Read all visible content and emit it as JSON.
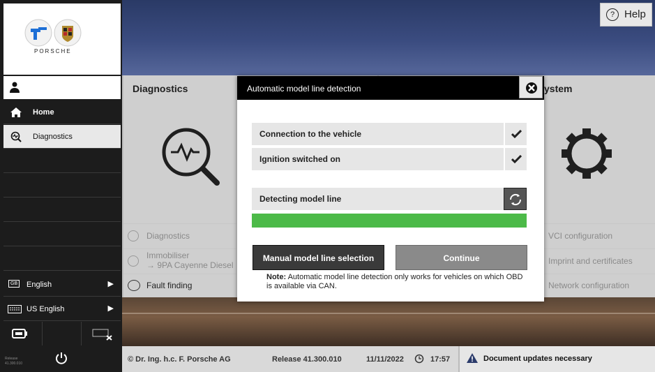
{
  "brand": {
    "logo_text": "PORSCHE"
  },
  "sidebar": {
    "items": [
      {
        "label": "Home",
        "icon": "home-icon"
      },
      {
        "label": "Diagnostics",
        "icon": "diagnostics-icon"
      }
    ],
    "language": "English",
    "language_badge": "GB",
    "keyboard": "US English",
    "release_small_label": "Release",
    "release_small_value": "41.300.010"
  },
  "header": {
    "help_label": "Help"
  },
  "tiles": {
    "diagnostics": {
      "title": "Diagnostics",
      "links": [
        "Diagnostics",
        "Immobiliser",
        "→ 9PA Cayenne Diesel",
        "Fault finding"
      ]
    },
    "system": {
      "title_suffix": "ystem",
      "links": [
        "VCI configuration",
        "Imprint and certificates",
        "Network configuration"
      ]
    }
  },
  "dialog": {
    "title": "Automatic model line detection",
    "steps": [
      {
        "label": "Connection to the vehicle",
        "status": "done"
      },
      {
        "label": "Ignition switched on",
        "status": "done"
      },
      {
        "label": "Detecting model line",
        "status": "in-progress"
      }
    ],
    "progress": 1.0,
    "manual_button": "Manual model line selection",
    "continue_button": "Continue",
    "note_label": "Note:",
    "note_text": "Automatic model line detection only works for vehicles on which OBD is available via CAN."
  },
  "footer": {
    "copyright": "© Dr. Ing. h.c. F. Porsche AG",
    "release": "Release 41.300.010",
    "date": "11/11/2022",
    "time": "17:57",
    "notice": "Document updates necessary"
  },
  "colors": {
    "progress": "#4cba48",
    "accent_dark": "#1f1f1f"
  }
}
